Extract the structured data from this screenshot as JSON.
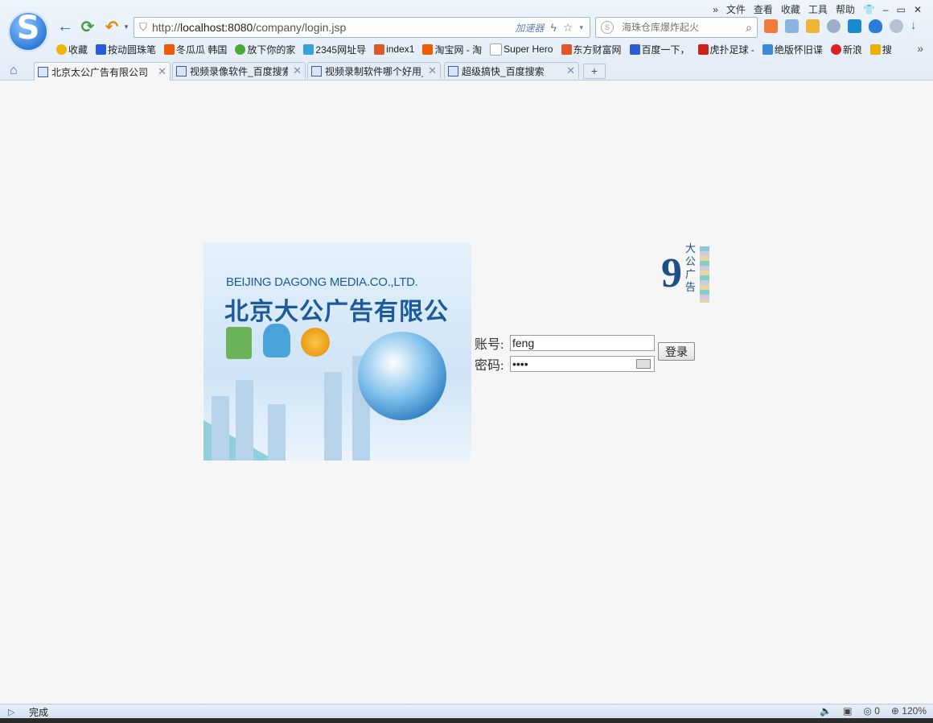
{
  "menu": [
    "»",
    "文件",
    "查看",
    "收藏",
    "工具",
    "帮助",
    "👕",
    "–",
    "▭",
    "✕"
  ],
  "address_bar": {
    "url_prefix": "http://",
    "url_host": "localhost:8080",
    "url_path": "/company/login.jsp",
    "accelerator": "加速器"
  },
  "search": {
    "placeholder": "海珠仓库爆炸起火"
  },
  "bookmarks": [
    {
      "label": "收藏",
      "color": "#f1b400"
    },
    {
      "label": "按动圆珠笔",
      "color": "#2b5bd7"
    },
    {
      "label": "冬瓜瓜 韩国",
      "color": "#f05a00"
    },
    {
      "label": "放下你的家",
      "color": "#4aa93a"
    },
    {
      "label": "2345网址导",
      "color": "#3aa0d8"
    },
    {
      "label": "index1",
      "color": "#d85a2a"
    },
    {
      "label": "淘宝网 - 淘",
      "color": "#f05a00"
    },
    {
      "label": "Super Hero",
      "color": "#9aa"
    },
    {
      "label": "东方财富网",
      "color": "#e2552a"
    },
    {
      "label": "百度一下，",
      "color": "#2b5bd7"
    },
    {
      "label": "虎扑足球 -",
      "color": "#c22"
    },
    {
      "label": "绝版怀旧谍",
      "color": "#3a8ad8"
    },
    {
      "label": "新浪",
      "color": "#d22"
    },
    {
      "label": "搜",
      "color": "#e8b000"
    }
  ],
  "tabs": [
    {
      "label": "北京太公广告有限公司",
      "active": true
    },
    {
      "label": "视频录像软件_百度搜索",
      "active": false
    },
    {
      "label": "视频录制软件哪个好用_百",
      "active": false
    },
    {
      "label": "超级搞快_百度搜索",
      "active": false
    }
  ],
  "banner": {
    "en": "BEIJING DAGONG MEDIA.CO.,LTD.",
    "cn": "北京大公广告有限公司"
  },
  "small_logo": {
    "numeral": "9",
    "text": "大公广告"
  },
  "login": {
    "account_label": "账号:",
    "account_value": "feng",
    "password_label": "密码:",
    "password_value": "••••",
    "submit": "登录"
  },
  "status": {
    "text": "完成",
    "count": "0",
    "zoom": "120%"
  }
}
